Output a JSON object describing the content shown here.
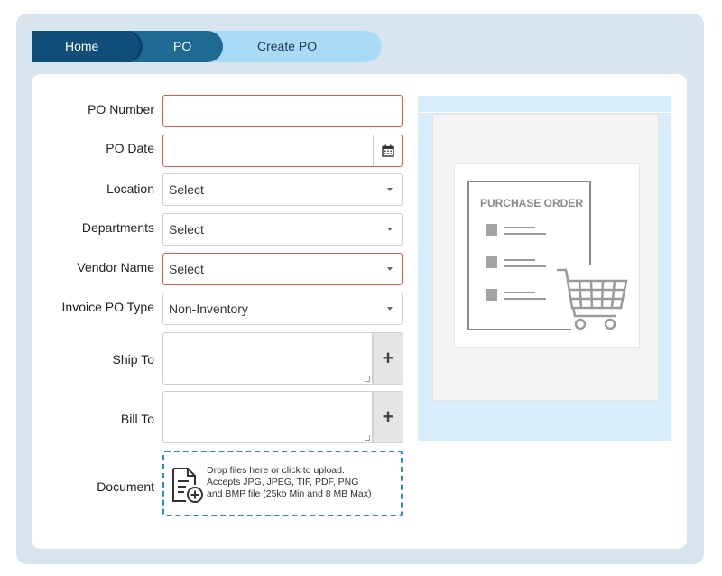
{
  "breadcrumb": {
    "items": [
      "Home",
      "PO",
      "Create PO"
    ]
  },
  "form": {
    "po_number_label": "PO Number",
    "po_number_value": "",
    "po_date_label": "PO Date",
    "po_date_value": "",
    "location_label": "Location",
    "location_value": "Select",
    "departments_label": "Departments",
    "departments_value": "Select",
    "vendor_name_label": "Vendor Name",
    "vendor_name_value": "Select",
    "invoice_po_type_label": "Invoice PO Type",
    "invoice_po_type_value": "Non-Inventory",
    "ship_to_label": "Ship To",
    "bill_to_label": "Bill To",
    "document_label": "Document",
    "upload_line1": "Drop files here or click to upload.",
    "upload_line2": "Accepts JPG, JPEG, TIF, PDF, PNG",
    "upload_line3": "and BMP file (25kb Min and 8 MB Max)"
  },
  "preview": {
    "heading": "PURCHASE ORDER"
  },
  "colors": {
    "required_border": "#e05a4f",
    "breadcrumb_home": "#0f4f79",
    "breadcrumb_po": "#1e6a95",
    "breadcrumb_current": "#a9dbf7",
    "upload_border": "#2a8ad8",
    "preview_bg": "#d8edfb"
  },
  "icons": {
    "calendar": "calendar-icon",
    "dropdown": "chevron-down-icon",
    "add": "plus-icon",
    "upload": "file-upload-icon",
    "cart": "shopping-cart-icon"
  }
}
